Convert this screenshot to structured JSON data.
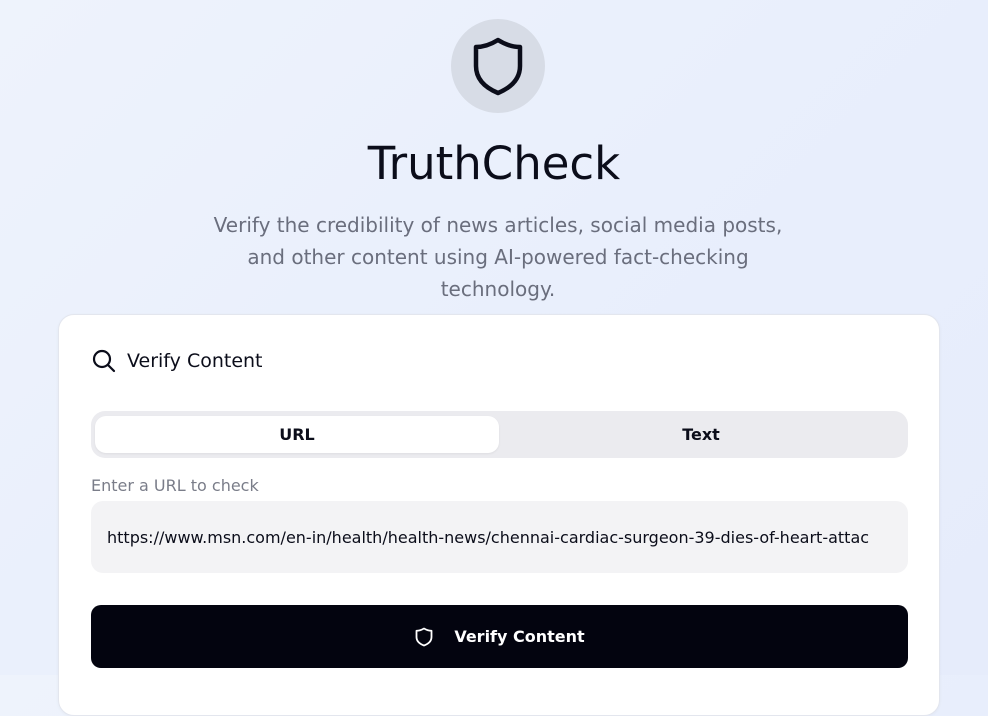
{
  "app": {
    "logo_icon": "shield-icon",
    "title": "TruthCheck",
    "subtitle": "Verify the credibility of news articles, social media posts, and other content using AI-powered fact-checking technology."
  },
  "card": {
    "header_icon": "search-icon",
    "title": "Verify Content",
    "tabs": [
      {
        "label": "URL",
        "selected": true
      },
      {
        "label": "Text",
        "selected": false
      }
    ],
    "url_field": {
      "label": "Enter a URL to check",
      "value": "https://www.msn.com/en-in/health/health-news/chennai-cardiac-surgeon-39-dies-of-heart-attac"
    },
    "submit": {
      "icon": "shield-icon",
      "label": "Verify Content"
    }
  },
  "colors": {
    "background": "#eef3fc",
    "logo_circle": "#d7dce6",
    "button_bg": "#03040f",
    "tab_track": "#ebebef",
    "muted_text": "#6a6e7d"
  }
}
